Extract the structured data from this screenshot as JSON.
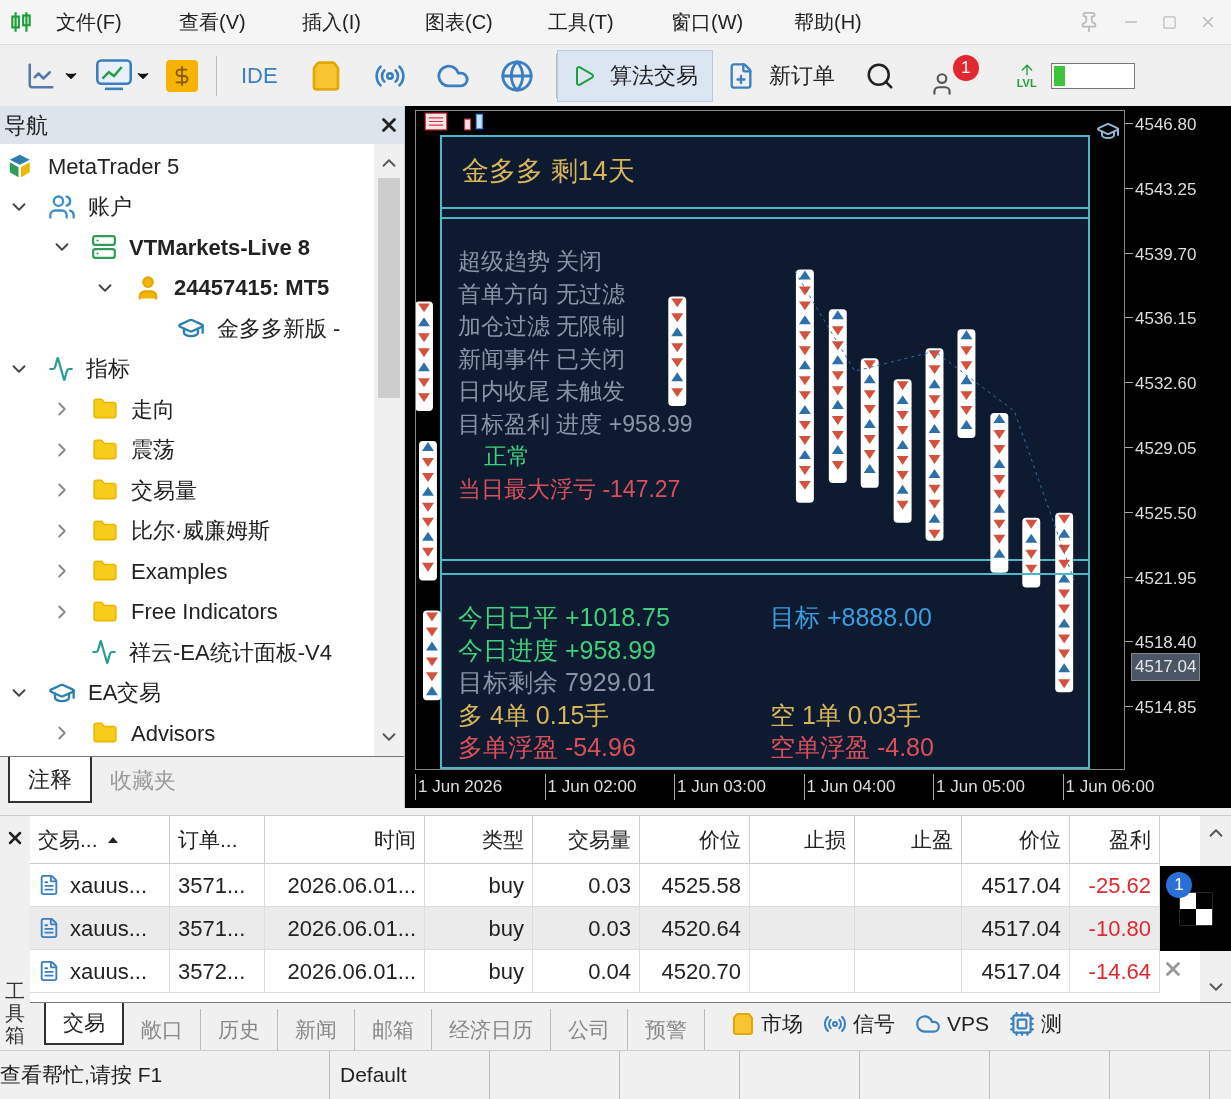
{
  "menu_bar": {
    "items": [
      "文件(F)",
      "查看(V)",
      "插入(I)",
      "图表(C)",
      "工具(T)",
      "窗口(W)",
      "帮助(H)"
    ]
  },
  "toolbar": {
    "ide_label": "IDE",
    "algo_trading": {
      "label": "算法交易",
      "selected": true
    },
    "new_order": "新订单",
    "notification_count": "1",
    "lvl_label": "LVL",
    "level": 0.15
  },
  "navigator": {
    "title": "导航",
    "root": "MetaTrader 5",
    "tree": [
      {
        "label": "账户",
        "kind": "accounts",
        "expanded": true,
        "children": [
          {
            "label": "VTMarkets-Live 8",
            "kind": "server",
            "expanded": true,
            "children": [
              {
                "label": "24457415: MT5",
                "kind": "account",
                "expanded": true,
                "children": [
                  {
                    "label": "金多多新版 -",
                    "kind": "ea"
                  }
                ]
              }
            ]
          }
        ]
      },
      {
        "label": "指标",
        "kind": "indicators",
        "expanded": true,
        "children": [
          {
            "label": "走向",
            "kind": "folder",
            "expanded": false
          },
          {
            "label": "震荡",
            "kind": "folder",
            "expanded": false
          },
          {
            "label": "交易量",
            "kind": "folder",
            "expanded": false
          },
          {
            "label": "比尔·威廉姆斯",
            "kind": "folder",
            "expanded": false
          },
          {
            "label": "Examples",
            "kind": "folder",
            "expanded": false
          },
          {
            "label": "Free Indicators",
            "kind": "folder",
            "expanded": false
          },
          {
            "label": "祥云-EA统计面板-V4",
            "kind": "indicator"
          }
        ]
      },
      {
        "label": "EA交易",
        "kind": "ea",
        "expanded": true,
        "children": [
          {
            "label": "Advisors",
            "kind": "folder",
            "expanded": false
          }
        ]
      }
    ],
    "tabs": [
      {
        "label": "注释",
        "selected": true
      },
      {
        "label": "收藏夹",
        "selected": false
      }
    ]
  },
  "chart": {
    "title": "金多多 剩14天",
    "status_lines": [
      {
        "text": "超级趋势 关闭",
        "color": "#8a94a8"
      },
      {
        "text": "首单方向 无过滤",
        "color": "#8a94a8"
      },
      {
        "text": "加仓过滤 无限制",
        "color": "#8a94a8"
      },
      {
        "text": "新闻事件 已关闭",
        "color": "#8a94a8"
      },
      {
        "text": "日内收尾 未触发",
        "color": "#8a94a8"
      },
      {
        "text": "目标盈利 进度 +958.99",
        "color": "#8a94a8"
      },
      {
        "text": "正常",
        "color": "#3fd07a"
      },
      {
        "text": "当日最大浮亏 -147.27",
        "color": "#d9505a"
      }
    ],
    "summary_rows": [
      {
        "left": {
          "text": "今日已平 +1018.75",
          "color": "#3fd07a"
        },
        "right": {
          "text": "目标 +8888.00",
          "color": "#3a9ee0"
        }
      },
      {
        "left": {
          "text": "今日进度 +958.99",
          "color": "#3fd07a"
        }
      },
      {
        "left": {
          "text": "目标剩余 7929.01",
          "color": "#8a94a8"
        }
      },
      {
        "left": {
          "text": "多 4单 0.15手",
          "color": "#d8b55a"
        },
        "right": {
          "text": "空 1单 0.03手",
          "color": "#d8b55a"
        }
      },
      {
        "left": {
          "text": "多单浮盈 -54.96",
          "color": "#d9505a"
        },
        "right": {
          "text": "空单浮盈 -4.80",
          "color": "#d9505a"
        }
      }
    ],
    "price_axis": [
      "4546.80",
      "4543.25",
      "4539.70",
      "4536.15",
      "4532.60",
      "4529.05",
      "4525.50",
      "4521.95",
      "4518.40",
      "4514.85"
    ],
    "current_price": "4517.04",
    "time_axis": [
      "1 Jun 2026",
      "1 Jun 02:00",
      "1 Jun 03:00",
      "1 Jun 04:00",
      "1 Jun 05:00",
      "1 Jun 06:00"
    ]
  },
  "toolbox": {
    "side_label": "工具箱",
    "columns": [
      {
        "label": "交易...",
        "sorted": true
      },
      {
        "label": "订单...",
        "sorted": false
      },
      {
        "label": "时间",
        "sorted": false
      },
      {
        "label": "类型",
        "sorted": false
      },
      {
        "label": "交易量",
        "sorted": false
      },
      {
        "label": "价位",
        "sorted": false
      },
      {
        "label": "止损",
        "sorted": false
      },
      {
        "label": "止盈",
        "sorted": false
      },
      {
        "label": "价位",
        "sorted": false
      },
      {
        "label": "盈利",
        "sorted": false
      }
    ],
    "rows": [
      {
        "cells": [
          "xauus...",
          "3571...",
          "2026.06.01...",
          "buy",
          "0.03",
          "4525.58",
          "",
          "",
          "4517.04",
          "-25.62"
        ],
        "hovered": false
      },
      {
        "cells": [
          "xauus...",
          "3571...",
          "2026.06.01...",
          "buy",
          "0.03",
          "4520.64",
          "",
          "",
          "4517.04",
          "-10.80"
        ],
        "hovered": true
      },
      {
        "cells": [
          "xauus...",
          "3572...",
          "2026.06.01...",
          "buy",
          "0.04",
          "4520.70",
          "",
          "",
          "4517.04",
          "-14.64"
        ],
        "hovered": false
      }
    ],
    "notification_count": "1",
    "tabs": [
      {
        "label": "交易",
        "selected": true
      },
      {
        "label": "敞口",
        "selected": false
      },
      {
        "label": "历史",
        "selected": false
      },
      {
        "label": "新闻",
        "selected": false
      },
      {
        "label": "邮箱",
        "selected": false
      },
      {
        "label": "经济日历",
        "selected": false
      },
      {
        "label": "公司",
        "selected": false
      },
      {
        "label": "预警",
        "selected": false
      }
    ],
    "services": [
      {
        "label": "市场",
        "kind": "market"
      },
      {
        "label": "信号",
        "kind": "signals"
      },
      {
        "label": "VPS",
        "kind": "vps"
      },
      {
        "label": "测",
        "kind": "tester"
      }
    ]
  },
  "status_bar": {
    "cells": [
      "查看帮忙,请按 F1",
      "Default"
    ]
  }
}
